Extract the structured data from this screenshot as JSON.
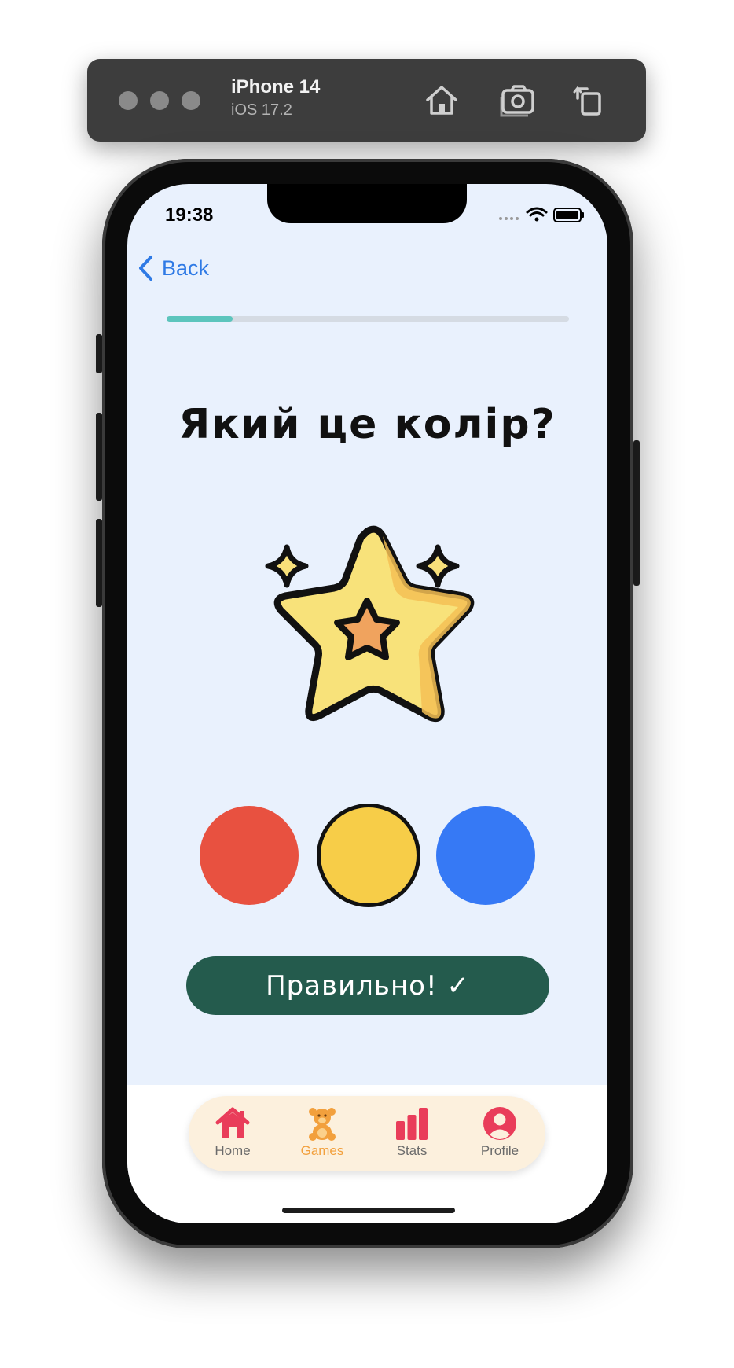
{
  "simulator": {
    "device_name": "iPhone 14",
    "os_version": "iOS 17.2",
    "toolbar_icons": [
      "home-icon",
      "screenshot-icon",
      "rotate-icon"
    ]
  },
  "status_bar": {
    "time": "19:38",
    "icons": [
      "cellular-icon",
      "wifi-icon",
      "battery-icon"
    ]
  },
  "nav": {
    "back_label": "Back"
  },
  "quiz": {
    "progress_fraction": 0.165,
    "question": "Який це колір?",
    "image": "star-icon",
    "choices": [
      {
        "name": "red",
        "color": "#e85140",
        "selected": false
      },
      {
        "name": "yellow",
        "color": "#f7cd48",
        "selected": true
      },
      {
        "name": "blue",
        "color": "#3679f5",
        "selected": false
      }
    ],
    "feedback": "Правильно! ✓"
  },
  "tabbar": {
    "items": [
      {
        "label": "Home",
        "icon": "house-icon",
        "color": "#e93d5a",
        "active": false
      },
      {
        "label": "Games",
        "icon": "teddy-bear-icon",
        "color": "#f2a03d",
        "active": true
      },
      {
        "label": "Stats",
        "icon": "bar-chart-icon",
        "color": "#e93d5a",
        "active": false
      },
      {
        "label": "Profile",
        "icon": "user-icon",
        "color": "#e93d5a",
        "active": false
      }
    ]
  }
}
